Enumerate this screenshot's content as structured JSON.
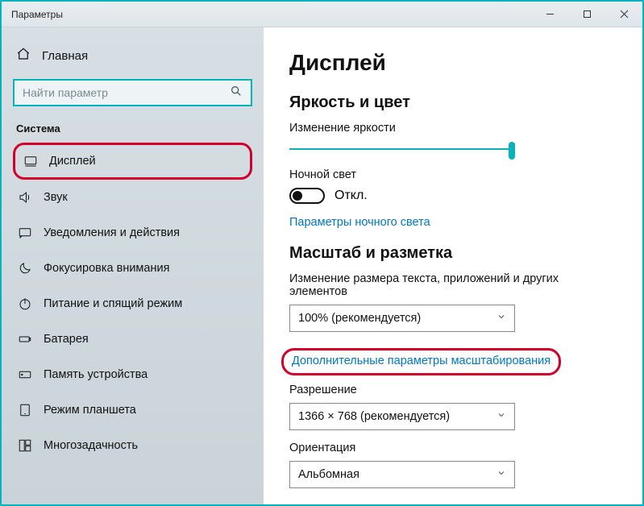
{
  "window": {
    "title": "Параметры"
  },
  "sidebar": {
    "home": "Главная",
    "search_placeholder": "Найти параметр",
    "section": "Система",
    "items": [
      "Дисплей",
      "Звук",
      "Уведомления и действия",
      "Фокусировка внимания",
      "Питание и спящий режим",
      "Батарея",
      "Память устройства",
      "Режим планшета",
      "Многозадачность"
    ]
  },
  "main": {
    "title": "Дисплей",
    "brightness": {
      "heading": "Яркость и цвет",
      "label": "Изменение яркости",
      "night_label": "Ночной свет",
      "night_state": "Откл.",
      "night_link": "Параметры ночного света"
    },
    "scale": {
      "heading": "Масштаб и разметка",
      "size_label": "Изменение размера текста, приложений и других элементов",
      "size_value": "100% (рекомендуется)",
      "advanced_link": "Дополнительные параметры масштабирования",
      "res_label": "Разрешение",
      "res_value": "1366 × 768 (рекомендуется)",
      "orient_label": "Ориентация",
      "orient_value": "Альбомная"
    }
  }
}
